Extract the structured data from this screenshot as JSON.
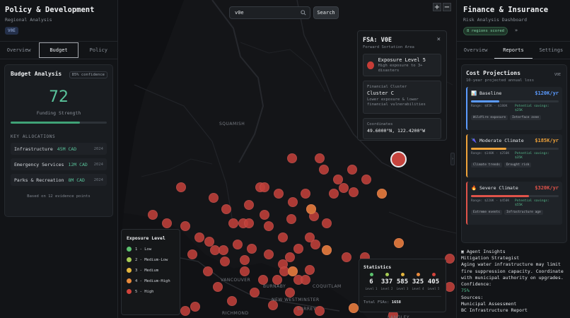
{
  "left_panel": {
    "title": "Policy & Development",
    "subtitle": "Regional Analysis",
    "tag": "V0E",
    "tabs": [
      "Overview",
      "Budget",
      "Policy"
    ],
    "active_tab": "Budget",
    "budget": {
      "title": "Budget Analysis",
      "confidence": "85% confidence",
      "score": "72",
      "score_label": "Funding Strength",
      "score_fraction": 0.72,
      "allocations_heading": "KEY ALLOCATIONS",
      "allocations": [
        {
          "name": "Infrastructure",
          "amount": "45M CAD",
          "year": "2024"
        },
        {
          "name": "Emergency Services",
          "amount": "12M CAD",
          "year": "2024"
        },
        {
          "name": "Parks & Recreation",
          "amount": "8M CAD",
          "year": "2024"
        }
      ],
      "evidence": "Based on 12 evidence points"
    }
  },
  "search": {
    "value": "v0e",
    "button": "Search"
  },
  "zoom": {
    "in": "+",
    "out": "−"
  },
  "fsa_popup": {
    "title": "FSA: V0E",
    "subtitle": "Forward Sortation Area",
    "close": "×",
    "exposure_title": "Exposure Level 5",
    "exposure_desc": "High exposure to 3+ disasters",
    "cluster_key": "Financial Cluster",
    "cluster_value": "Cluster C",
    "cluster_desc": "Lower exposure & lower financial vulnerabilities",
    "coords_key": "Coordinates",
    "coords_value": "49.6000°N, 122.4200°W"
  },
  "map_labels": [
    "SQUAMISH",
    "VANCOUVER",
    "BURNABY",
    "RICHMOND",
    "COQUITLAM",
    "SURREY",
    "NEW WESTMINSTER",
    "LANGLEY"
  ],
  "legend": {
    "title": "Exposure Level",
    "items": [
      {
        "label": "1 - Low",
        "color": "#5cc26e"
      },
      {
        "label": "2 - Medium-Low",
        "color": "#a6cc54"
      },
      {
        "label": "3 - Medium",
        "color": "#e3b53e"
      },
      {
        "label": "4 - Medium-High",
        "color": "#e88a3c"
      },
      {
        "label": "5 - High",
        "color": "#d2433b"
      }
    ]
  },
  "statistics": {
    "title": "Statistics",
    "levels": [
      {
        "count": "6",
        "label": "Level 1",
        "color": "#5cc26e"
      },
      {
        "count": "337",
        "label": "Level 2",
        "color": "#a6cc54"
      },
      {
        "count": "585",
        "label": "Level 3",
        "color": "#e3b53e"
      },
      {
        "count": "325",
        "label": "Level 4",
        "color": "#e88a3c"
      },
      {
        "count": "405",
        "label": "Level 5",
        "color": "#d2433b"
      }
    ],
    "total_label": "Total FSAs:",
    "total_value": "1658"
  },
  "right_panel": {
    "title": "Finance & Insurance",
    "subtitle": "Risk Analysis Dashboard",
    "badge": "8 regions scored",
    "chevron": "»",
    "tabs": [
      "Overview",
      "Reports",
      "Settings"
    ],
    "active_tab": "Reports",
    "cost": {
      "title": "Cost Projections",
      "code": "V0E",
      "subtitle": "10-year projected annual loss",
      "scenarios": [
        {
          "icon": "📊",
          "name": "Baseline",
          "value": "$120K/yr",
          "color": "#5b9bff",
          "fill": 0.32,
          "range": "Range: $85K - $180K",
          "savings": "Potential savings: $25K",
          "tags": [
            "Wildfire exposure",
            "Interface zone"
          ]
        },
        {
          "icon": "🌂",
          "name": "Moderate Climate",
          "value": "$185K/yr",
          "color": "#f0a33a",
          "fill": 0.4,
          "range": "Range: $140K - $250K",
          "savings": "Potential savings: $35K",
          "tags": [
            "Climate trends",
            "Drought risk"
          ]
        },
        {
          "icon": "🔥",
          "name": "Severe Climate",
          "value": "$320K/yr",
          "color": "#e0534a",
          "fill": 0.66,
          "range": "Range: $220K - $450K",
          "savings": "Potential savings: $55K",
          "tags": [
            "Extreme events",
            "Infrastructure age"
          ]
        }
      ]
    },
    "insights": {
      "heading": "Agent Insights",
      "role": "Mitigation Strategist",
      "text": "Aging water infrastructure may limit fire suppression capacity. Coordinate with municipal authority on upgrades.",
      "confidence_label": "Confidence:",
      "confidence_value": "75%",
      "sources_label": "Sources:",
      "sources": [
        "Municipal Assessment",
        "BC Infrastructure Report"
      ]
    }
  }
}
